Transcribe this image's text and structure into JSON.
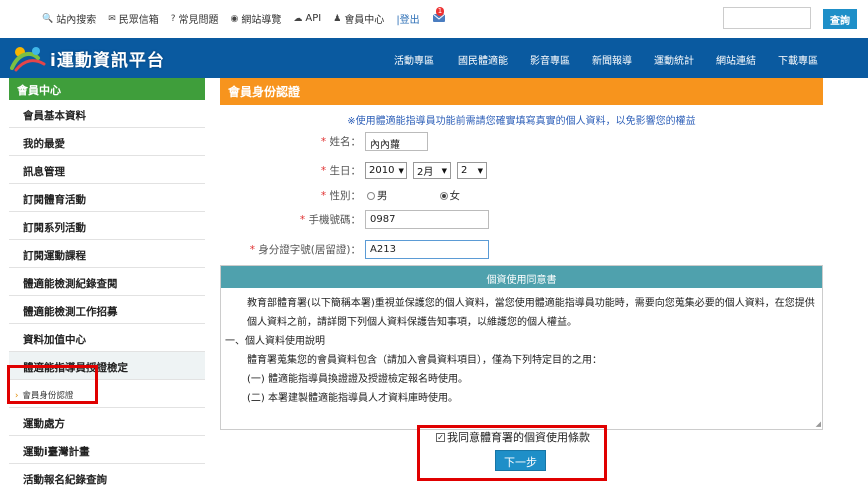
{
  "top_links": [
    {
      "icon": "search-icon",
      "glyph": "🔍",
      "label": "站內搜索"
    },
    {
      "icon": "mail-icon",
      "glyph": "✉",
      "label": "民眾信箱"
    },
    {
      "icon": "question-icon",
      "glyph": "?",
      "label": "常見問題"
    },
    {
      "icon": "globe-icon",
      "glyph": "◉",
      "label": "網站導覽"
    },
    {
      "icon": "cloud-icon",
      "glyph": "☁",
      "label": "API"
    },
    {
      "icon": "user-icon",
      "glyph": "♟",
      "label": "會員中心"
    }
  ],
  "logout_label": "|登出",
  "notification_count": "1",
  "search_button": "查詢",
  "logo_text": "i運動資訊平台",
  "nav": [
    "活動專區",
    "國民體適能",
    "影音專區",
    "新聞報導",
    "運動統計",
    "網站連結",
    "下載專區"
  ],
  "sidebar": {
    "header": "會員中心",
    "items": [
      "會員基本資料",
      "我的最愛",
      "訊息管理",
      "訂閱體育活動",
      "訂閱系列活動",
      "訂閱運動課程",
      "體適能檢測紀錄查閱",
      "體適能檢測工作招募",
      "資料加值中心",
      "體適能指導員授證檢定"
    ],
    "sub_item": "會員身份認證",
    "items_after": [
      "運動處方",
      "運動i臺灣計畫",
      "活動報名紀錄查詢"
    ]
  },
  "form": {
    "title": "會員身份認證",
    "notice": "※使用體適能指導員功能前需請您確實填寫真實的個人資料，以免影響您的權益",
    "name_label": "姓名：",
    "name_value": "內內蘿",
    "birthday_label": "生日：",
    "birth_year": "2010",
    "birth_month": "2月",
    "birth_day": "2",
    "gender_label": "性別：",
    "gender_male": "男",
    "gender_female": "女",
    "phone_label": "手機號碼：",
    "phone_value": "0987",
    "id_label": "身分證字號(居留證)：",
    "id_value": "A213"
  },
  "privacy": {
    "title": "個資使用同意書",
    "p1": "教育部體育署(以下簡稱本署)重視並保護您的個人資料，當您使用體適能指導員功能時，需要向您蒐集必要的個人資料，在您提供個人資料之前，請詳閱下列個人資料保護告知事項，以維護您的個人權益。",
    "s1": "一、個人資料使用說明",
    "p2": "體育署蒐集您的會員資料包含（請加入會員資料項目），僅為下列特定目的之用：",
    "p3": "(一) 體適能指導員換證證及授證檢定報名時使用。",
    "p4": "(二) 本署建製體適能指導員人才資料庫時使用。"
  },
  "agree_label": "我同意體育署的個資使用條款",
  "next_button": "下一步",
  "colors": {
    "brand_blue": "#0a5aa0",
    "sidebar_green": "#3f9e3b",
    "form_orange": "#f7941d",
    "privacy_teal": "#4fa1ad",
    "button_blue": "#1e8fc8",
    "highlight_red": "#e00000"
  }
}
